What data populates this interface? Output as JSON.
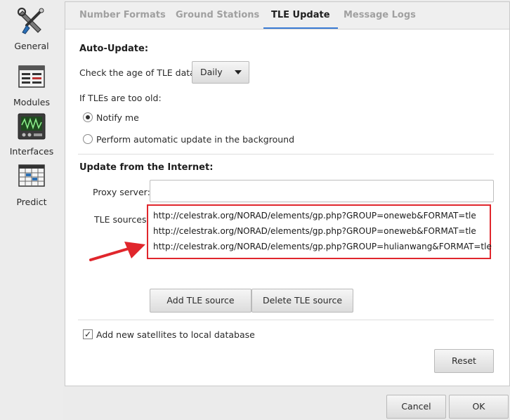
{
  "sidebar": {
    "items": [
      {
        "label": "General",
        "icon": "tools-icon"
      },
      {
        "label": "Modules",
        "icon": "module-grid-icon"
      },
      {
        "label": "Interfaces",
        "icon": "oscilloscope-icon"
      },
      {
        "label": "Predict",
        "icon": "calendar-grid-icon"
      }
    ]
  },
  "tabs": [
    {
      "label": "Number Formats"
    },
    {
      "label": "Ground Stations"
    },
    {
      "label": "TLE Update"
    },
    {
      "label": "Message Logs"
    }
  ],
  "auto_update": {
    "title": "Auto-Update:",
    "check_age_label": "Check the age of TLE data:",
    "interval_value": "Daily",
    "too_old_label": "If TLEs are too old:",
    "option_notify": "Notify me",
    "option_auto": "Perform automatic update in the background",
    "selected": "notify"
  },
  "internet": {
    "title": "Update from the Internet:",
    "proxy_label": "Proxy server:",
    "proxy_value": "",
    "sources_label": "TLE sources:",
    "sources": [
      "http://celestrak.org/NORAD/elements/gp.php?GROUP=oneweb&FORMAT=tle",
      "http://celestrak.org/NORAD/elements/gp.php?GROUP=oneweb&FORMAT=tle",
      "http://celestrak.org/NORAD/elements/gp.php?GROUP=hulianwang&FORMAT=tle"
    ],
    "add_button": "Add TLE source",
    "delete_button": "Delete TLE source"
  },
  "add_sats_label": "Add new satellites to local database",
  "add_sats_checked": true,
  "reset_button": "Reset",
  "cancel_button": "Cancel",
  "ok_button": "OK",
  "colors": {
    "highlight": "#e0262c",
    "active_tab_underline": "#3a7bd5"
  }
}
